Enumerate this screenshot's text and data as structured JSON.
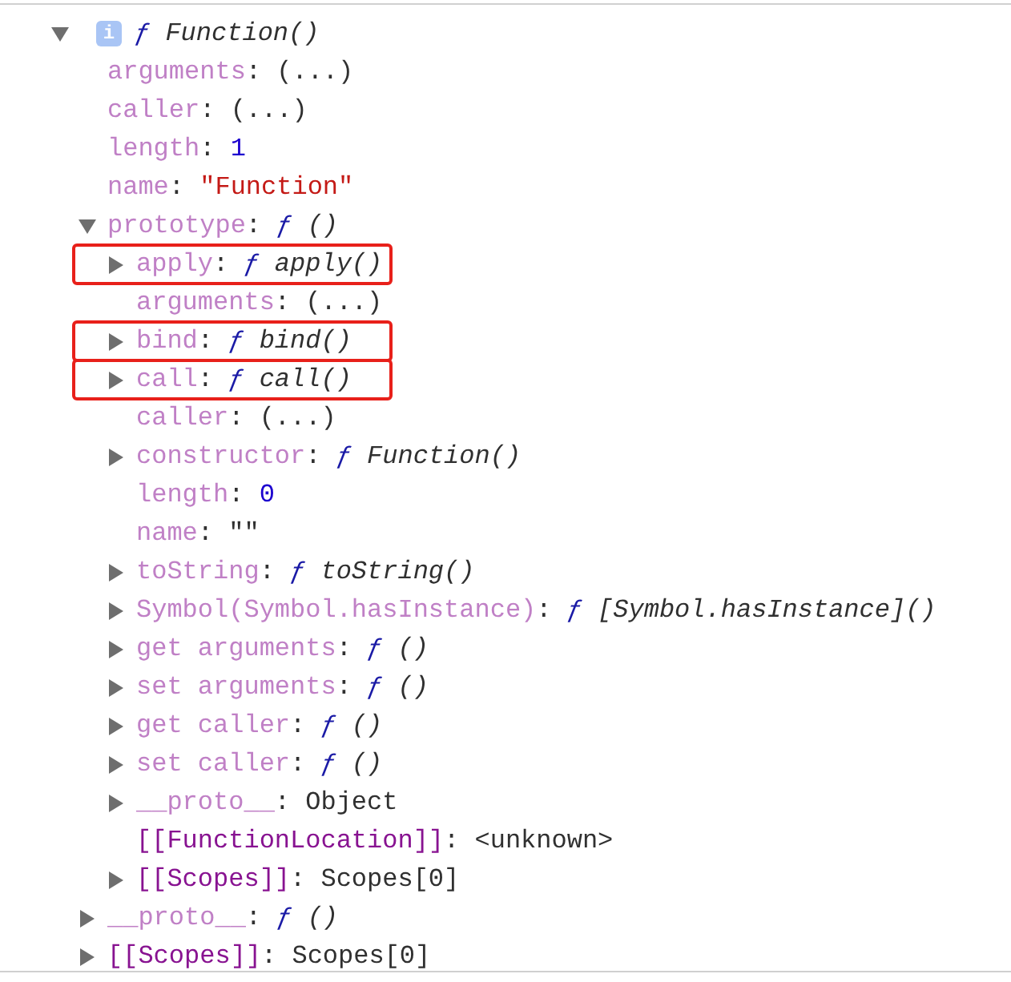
{
  "separator": ":",
  "root": {
    "expanded": true,
    "info_badge": "i",
    "prefix": "ƒ",
    "label": "Function()",
    "children": [
      {
        "key": "arguments",
        "value": "(...)",
        "kind": "plain"
      },
      {
        "key": "caller",
        "value": "(...)",
        "kind": "plain"
      },
      {
        "key": "length",
        "value": "1",
        "kind": "number"
      },
      {
        "key": "name",
        "value": "\"Function\"",
        "kind": "string"
      },
      {
        "key": "prototype",
        "prefix": "ƒ",
        "value": "()",
        "kind": "function",
        "expanded": true,
        "children": [
          {
            "key": "apply",
            "prefix": "ƒ",
            "value": "apply()",
            "kind": "function",
            "expanded": false,
            "highlighted": true
          },
          {
            "key": "arguments",
            "value": "(...)",
            "kind": "plain"
          },
          {
            "key": "bind",
            "prefix": "ƒ",
            "value": "bind()",
            "kind": "function",
            "expanded": false,
            "highlighted": true
          },
          {
            "key": "call",
            "prefix": "ƒ",
            "value": "call()",
            "kind": "function",
            "expanded": false,
            "highlighted": true
          },
          {
            "key": "caller",
            "value": "(...)",
            "kind": "plain"
          },
          {
            "key": "constructor",
            "prefix": "ƒ",
            "value": "Function()",
            "kind": "function",
            "expanded": false
          },
          {
            "key": "length",
            "value": "0",
            "kind": "number"
          },
          {
            "key": "name",
            "value": "\"\"",
            "kind": "plain"
          },
          {
            "key": "toString",
            "prefix": "ƒ",
            "value": "toString()",
            "kind": "function",
            "expanded": false
          },
          {
            "key": "Symbol(Symbol.hasInstance)",
            "prefix": "ƒ",
            "value": "[Symbol.hasInstance]()",
            "kind": "function",
            "expanded": false
          },
          {
            "key": "get arguments",
            "prefix": "ƒ",
            "value": "()",
            "kind": "function",
            "expanded": false
          },
          {
            "key": "set arguments",
            "prefix": "ƒ",
            "value": "()",
            "kind": "function",
            "expanded": false
          },
          {
            "key": "get caller",
            "prefix": "ƒ",
            "value": "()",
            "kind": "function",
            "expanded": false
          },
          {
            "key": "set caller",
            "prefix": "ƒ",
            "value": "()",
            "kind": "function",
            "expanded": false
          },
          {
            "key": "__proto__",
            "value": "Object",
            "kind": "plain",
            "expanded": false
          },
          {
            "key": "[[FunctionLocation]]",
            "value": "<unknown>",
            "kind": "internal"
          },
          {
            "key": "[[Scopes]]",
            "value": "Scopes[0]",
            "kind": "internal",
            "expanded": false
          }
        ]
      },
      {
        "key": "__proto__",
        "prefix": "ƒ",
        "value": "()",
        "kind": "function",
        "expanded": false
      },
      {
        "key": "[[Scopes]]",
        "value": "Scopes[0]",
        "kind": "internal",
        "expanded": false
      }
    ]
  }
}
